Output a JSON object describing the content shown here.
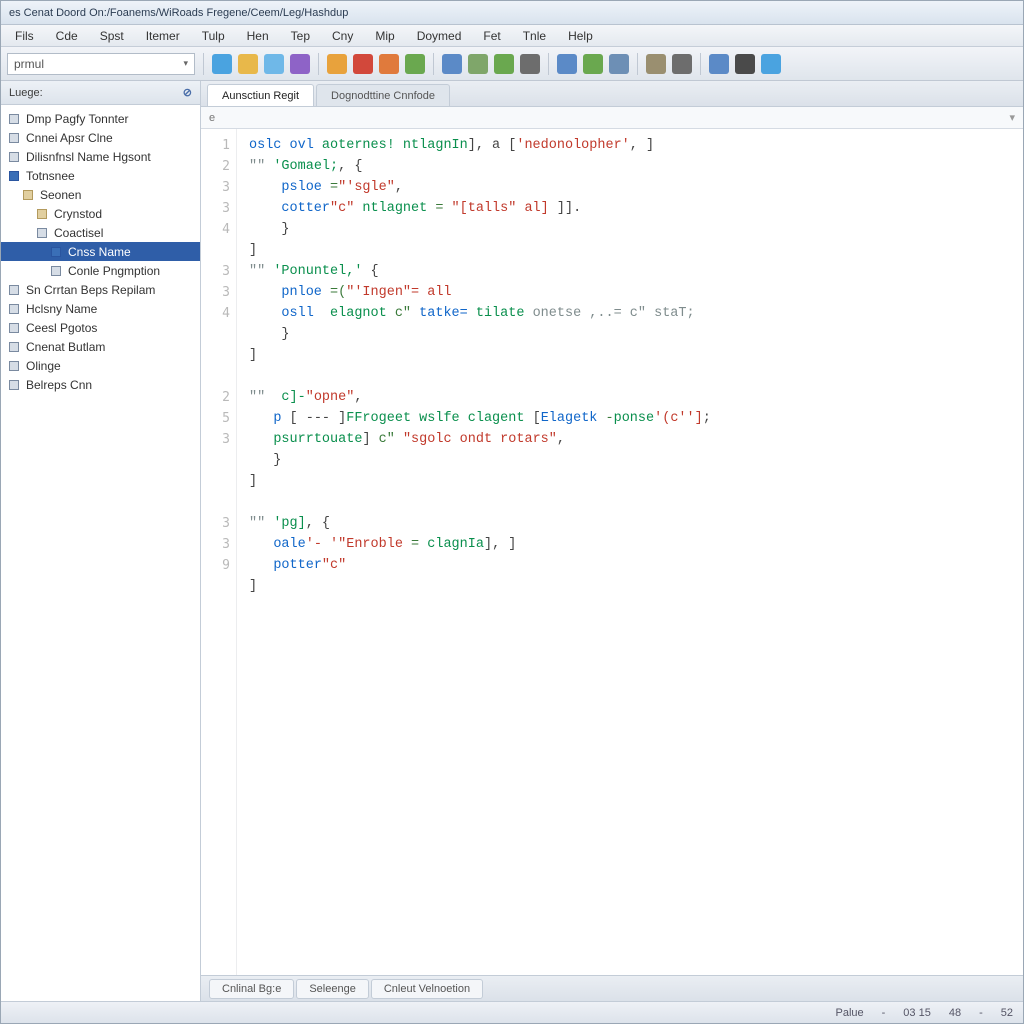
{
  "title": "es Cenat Doord On:/Foanems/WiRoads Fregene/Ceem/Leg/Hashdup",
  "menus": [
    "Fils",
    "Cde",
    "Spst",
    "Itemer",
    "Tulp",
    "Hen",
    "Tep",
    "Cny",
    "Mip",
    "Doymed",
    "Fet",
    "Tnle",
    "Help"
  ],
  "dropdown": {
    "value": "prmul"
  },
  "sidebar": {
    "header": "Luege:",
    "items": [
      {
        "label": "Dmp Pagfy Tonnter",
        "indent": 0,
        "icon": "sq grey"
      },
      {
        "label": "Cnnei Apsr Clne",
        "indent": 0,
        "icon": "sq grey"
      },
      {
        "label": "Dilisnfnsl Name Hgsont",
        "indent": 0,
        "icon": "sq grey"
      },
      {
        "label": "Totnsnee",
        "indent": 0,
        "icon": "sq blue"
      },
      {
        "label": "Seonen",
        "indent": 1,
        "icon": "sq tan"
      },
      {
        "label": "Crynstod",
        "indent": 2,
        "icon": "sq tan"
      },
      {
        "label": "Coactisel",
        "indent": 2,
        "icon": "sq grey"
      },
      {
        "label": "Cnss Name",
        "indent": 3,
        "icon": "sq blue",
        "selected": true
      },
      {
        "label": "Conle Pngmption",
        "indent": 3,
        "icon": "sq grey"
      },
      {
        "label": "Sn Crrtan Beps Repilam",
        "indent": 0,
        "icon": "sq grey"
      },
      {
        "label": "Hclsny Name",
        "indent": 0,
        "icon": "sq grey"
      },
      {
        "label": "Ceesl Pgotos",
        "indent": 0,
        "icon": "sq grey"
      },
      {
        "label": "Cnenat Butlam",
        "indent": 0,
        "icon": "sq grey"
      },
      {
        "label": "Olinge",
        "indent": 0,
        "icon": "sq grey"
      },
      {
        "label": "Belreps Cnn",
        "indent": 0,
        "icon": "sq grey"
      }
    ]
  },
  "tabs": [
    {
      "label": "Aunsctiun Regit",
      "active": true
    },
    {
      "label": "Dognodttine Cnnfode",
      "active": false
    }
  ],
  "breadcrumb": "e",
  "code": {
    "gutter": [
      "1",
      "2",
      "3",
      "3",
      "4",
      "",
      "3",
      "3",
      "4",
      "",
      "",
      "",
      "2",
      "5",
      "3",
      "",
      "",
      "",
      "3",
      "3",
      "9",
      ""
    ],
    "lines": [
      {
        "seg": [
          [
            "kw",
            "oslc ovl "
          ],
          [
            "id",
            "aoternes! ntlagnIn"
          ],
          [
            "pl",
            "], a ["
          ],
          [
            "str",
            "'nedonolopher'"
          ],
          [
            "pl",
            ", ]"
          ]
        ]
      },
      {
        "seg": [
          [
            "com",
            "\"\" "
          ],
          [
            "id",
            "'Gomael;"
          ],
          [
            "pl",
            ", {"
          ]
        ]
      },
      {
        "seg": [
          [
            "pl",
            "    "
          ],
          [
            "kw",
            "psloe "
          ],
          [
            "op",
            "="
          ],
          [
            "str",
            "\"'sgle\""
          ],
          [
            "pl",
            ","
          ]
        ]
      },
      {
        "seg": [
          [
            "pl",
            "    "
          ],
          [
            "kw",
            "cotter"
          ],
          [
            "str",
            "\"c\" "
          ],
          [
            "id",
            "ntlagnet "
          ],
          [
            "op",
            "= "
          ],
          [
            "str",
            "\"[talls\" al]"
          ],
          [
            "pl",
            " ]]."
          ]
        ]
      },
      {
        "seg": [
          [
            "pl",
            "    }"
          ]
        ]
      },
      {
        "seg": [
          [
            "pl",
            "]"
          ]
        ]
      },
      {
        "seg": [
          [
            "com",
            "\"\" "
          ],
          [
            "id",
            "'Ponuntel,' "
          ],
          [
            "pl",
            "{"
          ]
        ]
      },
      {
        "seg": [
          [
            "pl",
            "    "
          ],
          [
            "kw",
            "pnloe "
          ],
          [
            "op",
            "=("
          ],
          [
            "str",
            "\"'Ingen\"= all"
          ]
        ]
      },
      {
        "seg": [
          [
            "pl",
            "    "
          ],
          [
            "kw",
            "osll  "
          ],
          [
            "id",
            "elagnot "
          ],
          [
            "op",
            "c\" "
          ],
          [
            "kw",
            "tatke= "
          ],
          [
            "id",
            "tilate "
          ],
          [
            "com",
            "onetse ,..= c\" staT;"
          ]
        ]
      },
      {
        "seg": [
          [
            "pl",
            "    }"
          ]
        ]
      },
      {
        "seg": [
          [
            "pl",
            "]"
          ]
        ]
      },
      {
        "seg": [
          [
            "pl",
            ""
          ]
        ]
      },
      {
        "seg": [
          [
            "com",
            "\"\" "
          ],
          [
            "id",
            " c]-"
          ],
          [
            "str",
            "\"opne\""
          ],
          [
            "pl",
            ","
          ]
        ]
      },
      {
        "seg": [
          [
            "pl",
            "   "
          ],
          [
            "kw",
            "p "
          ],
          [
            "pl",
            "[ --- ]"
          ],
          [
            "id",
            "FFrogeet wslfe clagent "
          ],
          [
            "pl",
            "["
          ],
          [
            "kw",
            "Elagetk "
          ],
          [
            "op",
            "-"
          ],
          [
            "id",
            "ponse"
          ],
          [
            "str",
            "'(c'']"
          ],
          [
            "pl",
            ";"
          ]
        ]
      },
      {
        "seg": [
          [
            "pl",
            "   "
          ],
          [
            "id",
            "psurrtouate"
          ],
          [
            "pl",
            "] "
          ],
          [
            "op",
            "c\" "
          ],
          [
            "str",
            "\"sgolc ondt rotars\""
          ],
          [
            "pl",
            ","
          ]
        ]
      },
      {
        "seg": [
          [
            "pl",
            "   }"
          ]
        ]
      },
      {
        "seg": [
          [
            "pl",
            "]"
          ]
        ]
      },
      {
        "seg": [
          [
            "pl",
            ""
          ]
        ]
      },
      {
        "seg": [
          [
            "com",
            "\"\" "
          ],
          [
            "id",
            "'pg]"
          ],
          [
            "pl",
            ", {"
          ]
        ]
      },
      {
        "seg": [
          [
            "pl",
            "   "
          ],
          [
            "kw",
            "oale"
          ],
          [
            "str",
            "'- '"
          ],
          [
            "str",
            "\"Enroble "
          ],
          [
            "op",
            "= "
          ],
          [
            "id",
            "clagnIa"
          ],
          [
            "pl",
            "], ]"
          ]
        ]
      },
      {
        "seg": [
          [
            "pl",
            "   "
          ],
          [
            "kw",
            "potter"
          ],
          [
            "str",
            "\"c\""
          ]
        ]
      },
      {
        "seg": [
          [
            "pl",
            "]"
          ]
        ]
      }
    ]
  },
  "bottom_tabs": [
    "Cnlinal Bg:e",
    "Seleenge",
    "Cnleut Velnoetion"
  ],
  "status": {
    "label": "Palue",
    "sep": "-",
    "col1": "03 15",
    "col2": "48",
    "col3": "-",
    "col4": "52"
  },
  "icons": {
    "colors": [
      "#4aa3e0",
      "#e8b84a",
      "#6fb8e8",
      "#8e63c7",
      "#e8a23c",
      "#d2483b",
      "#e07a3c",
      "#6aa84f",
      "#5b8ac7",
      "#7fa66a",
      "#6aa84f",
      "#6d6d6d",
      "#5b8ac7",
      "#6aa84f",
      "#6d8fb5",
      "#9a8f70",
      "#6d6d6d",
      "#5b8ac7",
      "#4a4a4a",
      "#4aa3e0"
    ]
  }
}
